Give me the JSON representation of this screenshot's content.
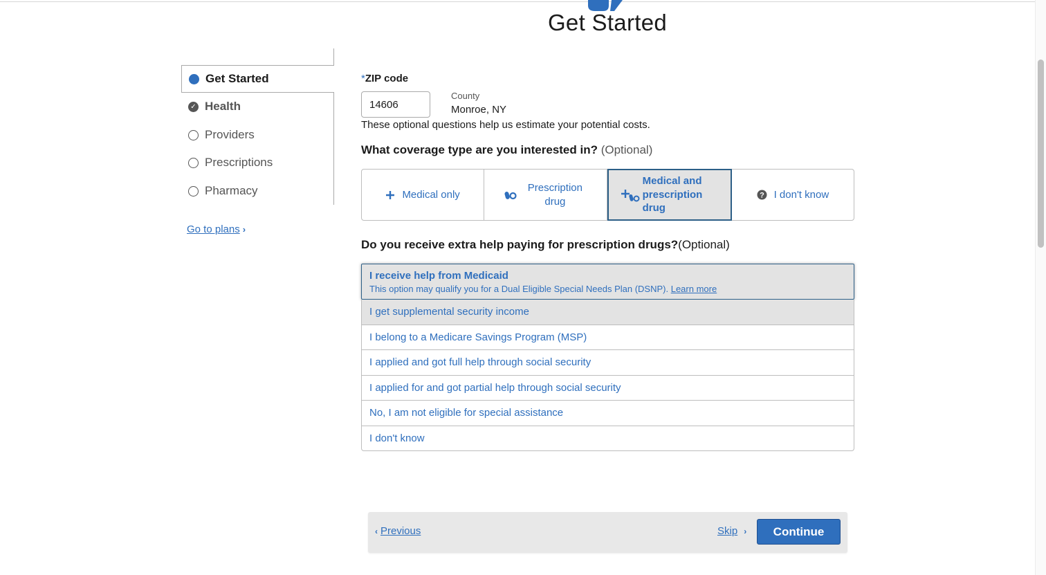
{
  "page": {
    "title": "Get Started"
  },
  "sidebar": {
    "items": [
      {
        "label": "Get Started",
        "state": "current"
      },
      {
        "label": "Health",
        "state": "complete"
      },
      {
        "label": "Providers",
        "state": "incomplete"
      },
      {
        "label": "Prescriptions",
        "state": "incomplete"
      },
      {
        "label": "Pharmacy",
        "state": "incomplete"
      }
    ],
    "go_to_plans": "Go to plans"
  },
  "zip": {
    "required_mark": "*",
    "label": "ZIP code",
    "value": "14606",
    "county_label": "County",
    "county_value": "Monroe, NY"
  },
  "optional_note": "These optional questions help us estimate your potential costs.",
  "coverage": {
    "question": "What coverage type are you interested in?",
    "optional": "(Optional)",
    "options": [
      {
        "label": "Medical only",
        "icon": "plus-icon",
        "selected": false
      },
      {
        "label": "Prescription drug",
        "icon": "pills-icon",
        "selected": false
      },
      {
        "label": "Medical and prescription drug",
        "icon": "plus-pills-icon",
        "selected": true
      },
      {
        "label": "I don't know",
        "icon": "question-circle-icon",
        "selected": false
      }
    ]
  },
  "extra_help": {
    "question": "Do you receive extra help paying for prescription drugs?",
    "optional": "(Optional)",
    "options": [
      {
        "label": "I receive help from Medicaid",
        "sub": "This option may qualify you for a Dual Eligible Special Needs Plan (DSNP).",
        "learn_more": "Learn more",
        "selected": true
      },
      {
        "label": "I get supplemental security income"
      },
      {
        "label": "I belong to a Medicare Savings Program (MSP)"
      },
      {
        "label": "I applied and got full help through social security"
      },
      {
        "label": "I applied for and got partial help through social security"
      },
      {
        "label": "No, I am not eligible for special assistance"
      },
      {
        "label": "I don't know"
      }
    ]
  },
  "footer": {
    "previous": "Previous",
    "skip": "Skip",
    "continue": "Continue"
  },
  "colors": {
    "accent": "#2f6fbd",
    "selected_border": "#2c5f87",
    "selected_bg": "#e3e3e3"
  }
}
